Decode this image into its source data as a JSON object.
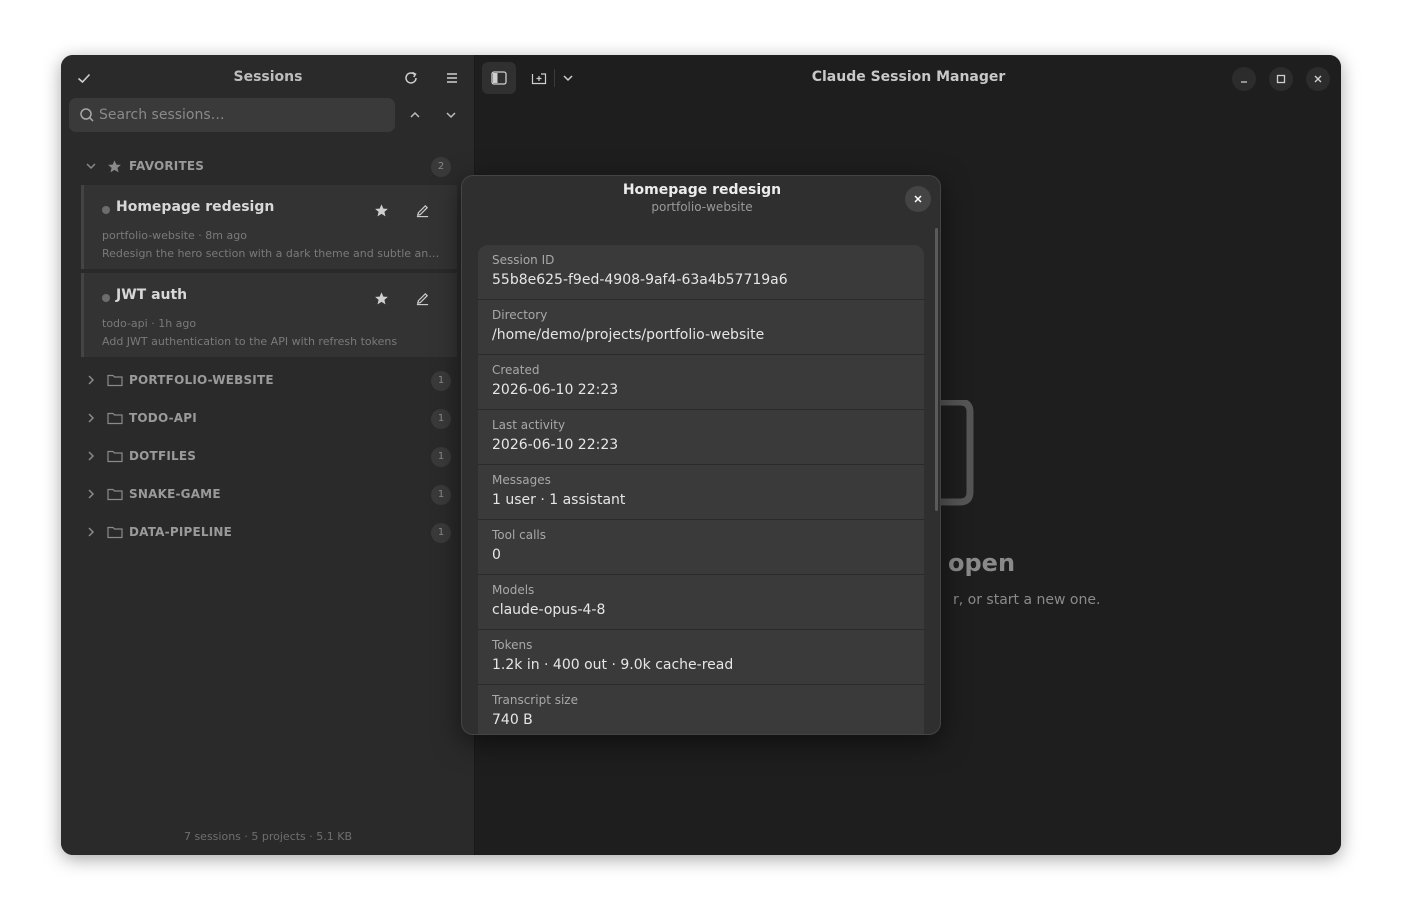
{
  "sidebar": {
    "title": "Sessions",
    "search_placeholder": "Search sessions…",
    "favorites": {
      "label": "FAVORITES",
      "count": "2"
    },
    "sessions": [
      {
        "title": "Homepage redesign",
        "meta": "portfolio-website · 8m ago",
        "desc": "Redesign the hero section with a dark theme and subtle ani…"
      },
      {
        "title": "JWT auth",
        "meta": "todo-api · 1h ago",
        "desc": "Add JWT authentication to the API with refresh tokens"
      }
    ],
    "projects": [
      {
        "label": "PORTFOLIO-WEBSITE",
        "count": "1"
      },
      {
        "label": "TODO-API",
        "count": "1"
      },
      {
        "label": "DOTFILES",
        "count": "1"
      },
      {
        "label": "SNAKE-GAME",
        "count": "1"
      },
      {
        "label": "DATA-PIPELINE",
        "count": "1"
      }
    ],
    "footer": "7 sessions · 5 projects · 5.1 KB"
  },
  "main": {
    "app_title": "Claude Session Manager",
    "empty_title": "open",
    "empty_subtitle": "r, or start a new one."
  },
  "dialog": {
    "title": "Homepage redesign",
    "subtitle": "portfolio-website",
    "props": [
      {
        "label": "Session ID",
        "value": "55b8e625-f9ed-4908-9af4-63a4b57719a6"
      },
      {
        "label": "Directory",
        "value": "/home/demo/projects/portfolio-website"
      },
      {
        "label": "Created",
        "value": "2026-06-10 22:23"
      },
      {
        "label": "Last activity",
        "value": "2026-06-10 22:23"
      },
      {
        "label": "Messages",
        "value": "1 user · 1 assistant"
      },
      {
        "label": "Tool calls",
        "value": "0"
      },
      {
        "label": "Models",
        "value": "claude-opus-4-8"
      },
      {
        "label": "Tokens",
        "value": "1.2k in · 400 out · 9.0k cache-read"
      },
      {
        "label": "Transcript size",
        "value": "740 B"
      }
    ]
  },
  "colors": {
    "window_bg": "#1e1e1e",
    "sidebar_bg": "#2a2a2a",
    "dialog_bg": "#2f2f2f",
    "row_bg": "#3a3a3a"
  }
}
